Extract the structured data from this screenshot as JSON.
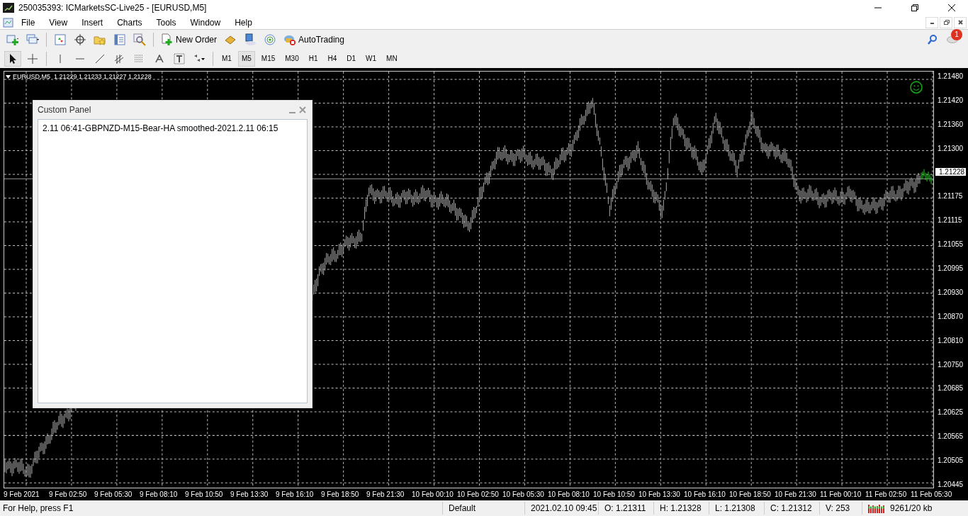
{
  "window": {
    "title": "250035393: ICMarketsSC-Live25 - [EURUSD,M5]"
  },
  "menu": {
    "items": [
      "File",
      "View",
      "Insert",
      "Charts",
      "Tools",
      "Window",
      "Help"
    ]
  },
  "toolbar": {
    "new_order": "New Order",
    "auto_trading": "AutoTrading",
    "notifications": "1"
  },
  "timeframes": [
    {
      "label": "M1",
      "selected": false
    },
    {
      "label": "M5",
      "selected": true
    },
    {
      "label": "M15",
      "selected": false
    },
    {
      "label": "M30",
      "selected": false
    },
    {
      "label": "H1",
      "selected": false
    },
    {
      "label": "H4",
      "selected": false
    },
    {
      "label": "D1",
      "selected": false
    },
    {
      "label": "W1",
      "selected": false
    },
    {
      "label": "MN",
      "selected": false
    }
  ],
  "chart": {
    "symbol_info": "EURUSD,M5  1.21229 1.21233 1.21227 1.21228",
    "price_labels": [
      "1.21480",
      "1.21420",
      "1.21360",
      "1.21300",
      "1.21175",
      "1.21115",
      "1.21055",
      "1.20995",
      "1.20930",
      "1.20870",
      "1.20810",
      "1.20750",
      "1.20685",
      "1.20625",
      "1.20565",
      "1.20505",
      "1.20445"
    ],
    "current_price": "1.21228",
    "time_labels": [
      "9 Feb 2021",
      "9 Feb 02:50",
      "9 Feb 05:30",
      "9 Feb 08:10",
      "9 Feb 10:50",
      "9 Feb 13:30",
      "9 Feb 16:10",
      "9 Feb 18:50",
      "9 Feb 21:30",
      "10 Feb 00:10",
      "10 Feb 02:50",
      "10 Feb 05:30",
      "10 Feb 08:10",
      "10 Feb 10:50",
      "10 Feb 13:30",
      "10 Feb 16:10",
      "10 Feb 18:50",
      "10 Feb 21:30",
      "11 Feb 00:10",
      "11 Feb 02:50",
      "11 Feb 05:30"
    ]
  },
  "panel": {
    "title": "Custom Panel",
    "lines": [
      "2.11 06:41-GBPNZD-M15-Bear-HA smoothed-2021.2.11 06:15"
    ]
  },
  "status_bar": {
    "help": "For Help, press F1",
    "profile": "Default",
    "datetime": "2021.02.10 09:45",
    "open": "O: 1.21311",
    "high": "H: 1.21328",
    "low": "L: 1.21308",
    "close": "C: 1.21312",
    "volume": "V: 253",
    "traffic": "9261/20 kb"
  }
}
